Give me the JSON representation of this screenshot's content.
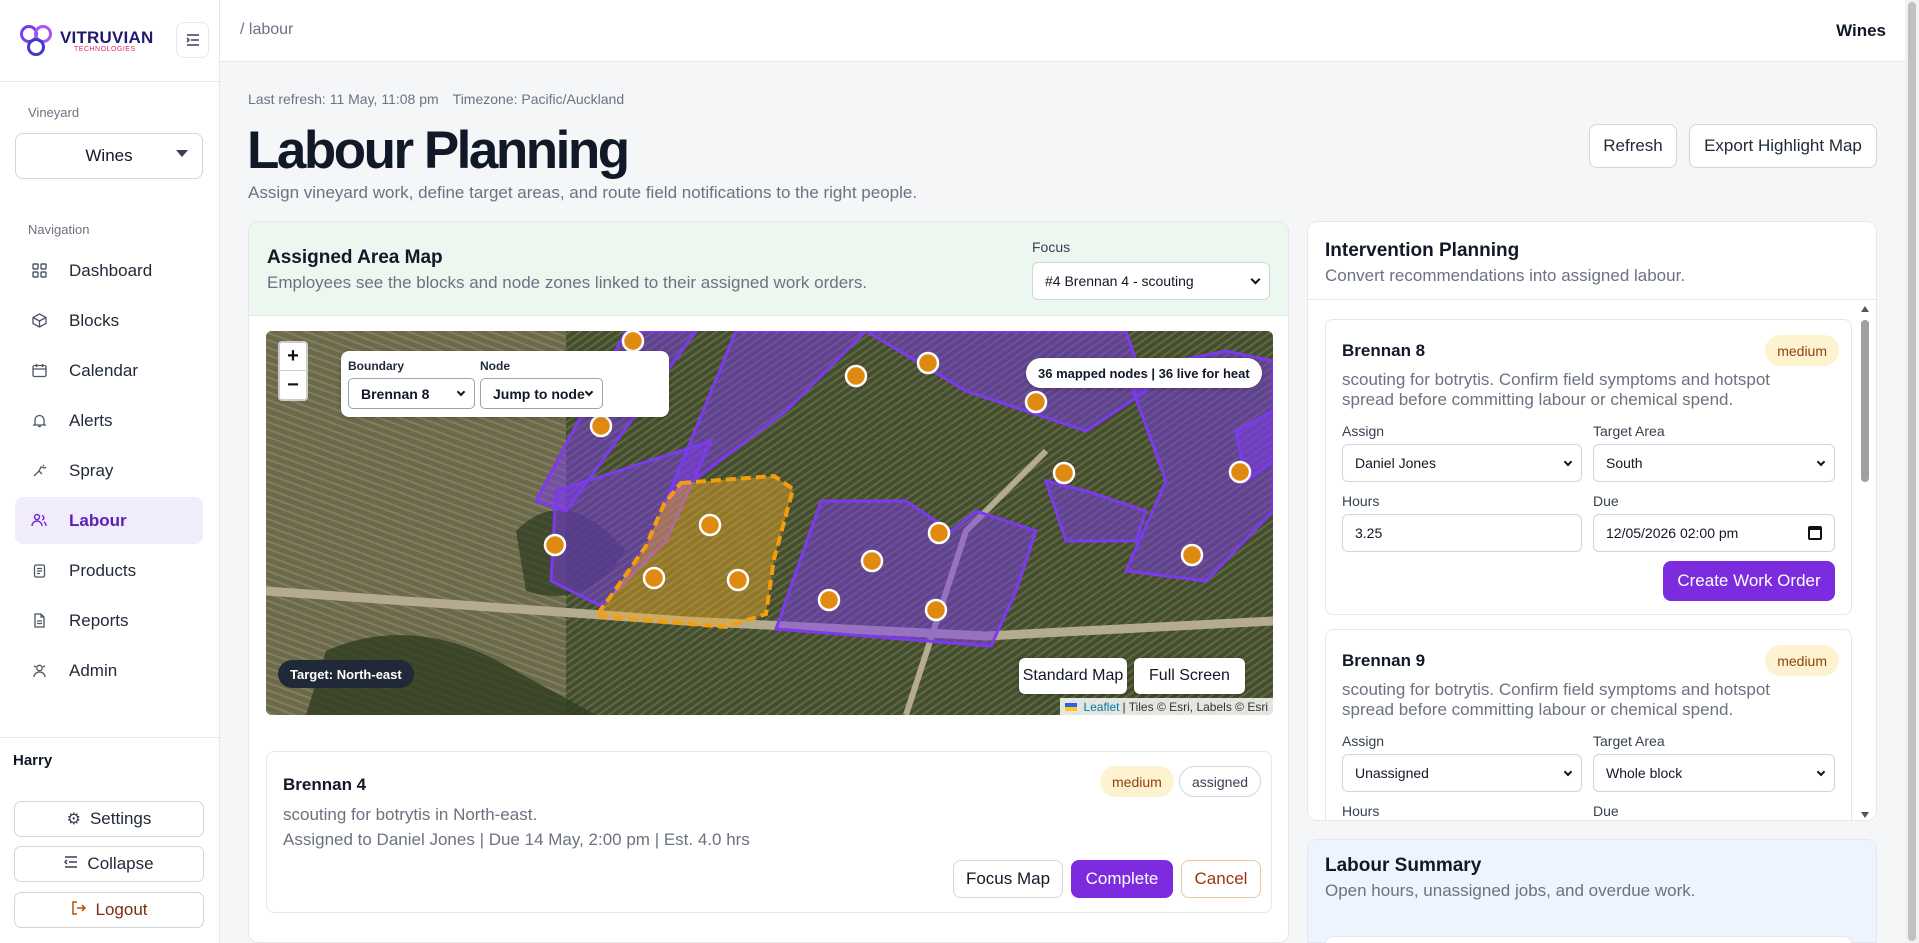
{
  "brand": {
    "name": "VITRUVIAN",
    "tagline": "TECHNOLOGIES"
  },
  "sidebar": {
    "vineyard_label": "Vineyard",
    "vineyard_value": "Wines",
    "nav_label": "Navigation",
    "items": [
      {
        "label": "Dashboard",
        "icon": "grid-icon"
      },
      {
        "label": "Blocks",
        "icon": "cube-icon"
      },
      {
        "label": "Calendar",
        "icon": "calendar-icon"
      },
      {
        "label": "Alerts",
        "icon": "bell-icon"
      },
      {
        "label": "Spray",
        "icon": "spray-icon"
      },
      {
        "label": "Labour",
        "icon": "people-icon",
        "active": true
      },
      {
        "label": "Products",
        "icon": "clipboard-icon"
      },
      {
        "label": "Reports",
        "icon": "document-icon"
      },
      {
        "label": "Admin",
        "icon": "admin-icon"
      }
    ],
    "user": "Harry",
    "settings_label": "Settings",
    "collapse_label": "Collapse",
    "logout_label": "Logout"
  },
  "topbar": {
    "breadcrumb": "/ labour",
    "vineyard": "Wines"
  },
  "header": {
    "last_refresh": "Last refresh: 11 May, 11:08 pm",
    "timezone": "Timezone: Pacific/Auckland",
    "title": "Labour Planning",
    "subtitle": "Assign vineyard work, define target areas, and route field notifications to the right people.",
    "refresh_label": "Refresh",
    "export_label": "Export Highlight Map"
  },
  "map_card": {
    "title": "Assigned Area Map",
    "subtitle": "Employees see the blocks and node zones linked to their assigned work orders.",
    "focus_label": "Focus",
    "focus_value": "#4 Brennan 4 - scouting",
    "boundary_label": "Boundary",
    "boundary_value": "Brennan 8",
    "node_label": "Node",
    "node_value": "Jump to node",
    "nodes_badge": "36 mapped nodes | 36 live for heat",
    "target_badge": "Target: North-east",
    "standard_map_label": "Standard Map",
    "full_screen_label": "Full Screen",
    "attribution_leaflet": "Leaflet",
    "attribution_rest": "| Tiles © Esri, Labels © Esri",
    "colors": {
      "block": "#7c3aed",
      "target": "#f59e0b",
      "node": "#e08a12"
    }
  },
  "work_order": {
    "title": "Brennan 4",
    "priority": "medium",
    "status": "assigned",
    "description": "scouting for botrytis in North-east.",
    "meta": "Assigned to Daniel Jones | Due 14 May, 2:00 pm | Est. 4.0 hrs",
    "focus_label": "Focus Map",
    "complete_label": "Complete",
    "cancel_label": "Cancel"
  },
  "intervention": {
    "title": "Intervention Planning",
    "subtitle": "Convert recommendations into assigned labour.",
    "assign_label": "Assign",
    "target_label": "Target Area",
    "hours_label": "Hours",
    "due_label": "Due",
    "create_label": "Create Work Order",
    "recommendations": [
      {
        "title": "Brennan 8",
        "priority": "medium",
        "description": "scouting for botrytis. Confirm field symptoms and hotspot spread before committing labour or chemical spend.",
        "assign": "Daniel Jones",
        "target": "South",
        "hours": "3.25",
        "due": "12/05/2026 02:00 pm"
      },
      {
        "title": "Brennan 9",
        "priority": "medium",
        "description": "scouting for botrytis. Confirm field symptoms and hotspot spread before committing labour or chemical spend.",
        "assign": "Unassigned",
        "target": "Whole block"
      }
    ]
  },
  "summary": {
    "title": "Labour Summary",
    "subtitle": "Open hours, unassigned jobs, and overdue work."
  }
}
